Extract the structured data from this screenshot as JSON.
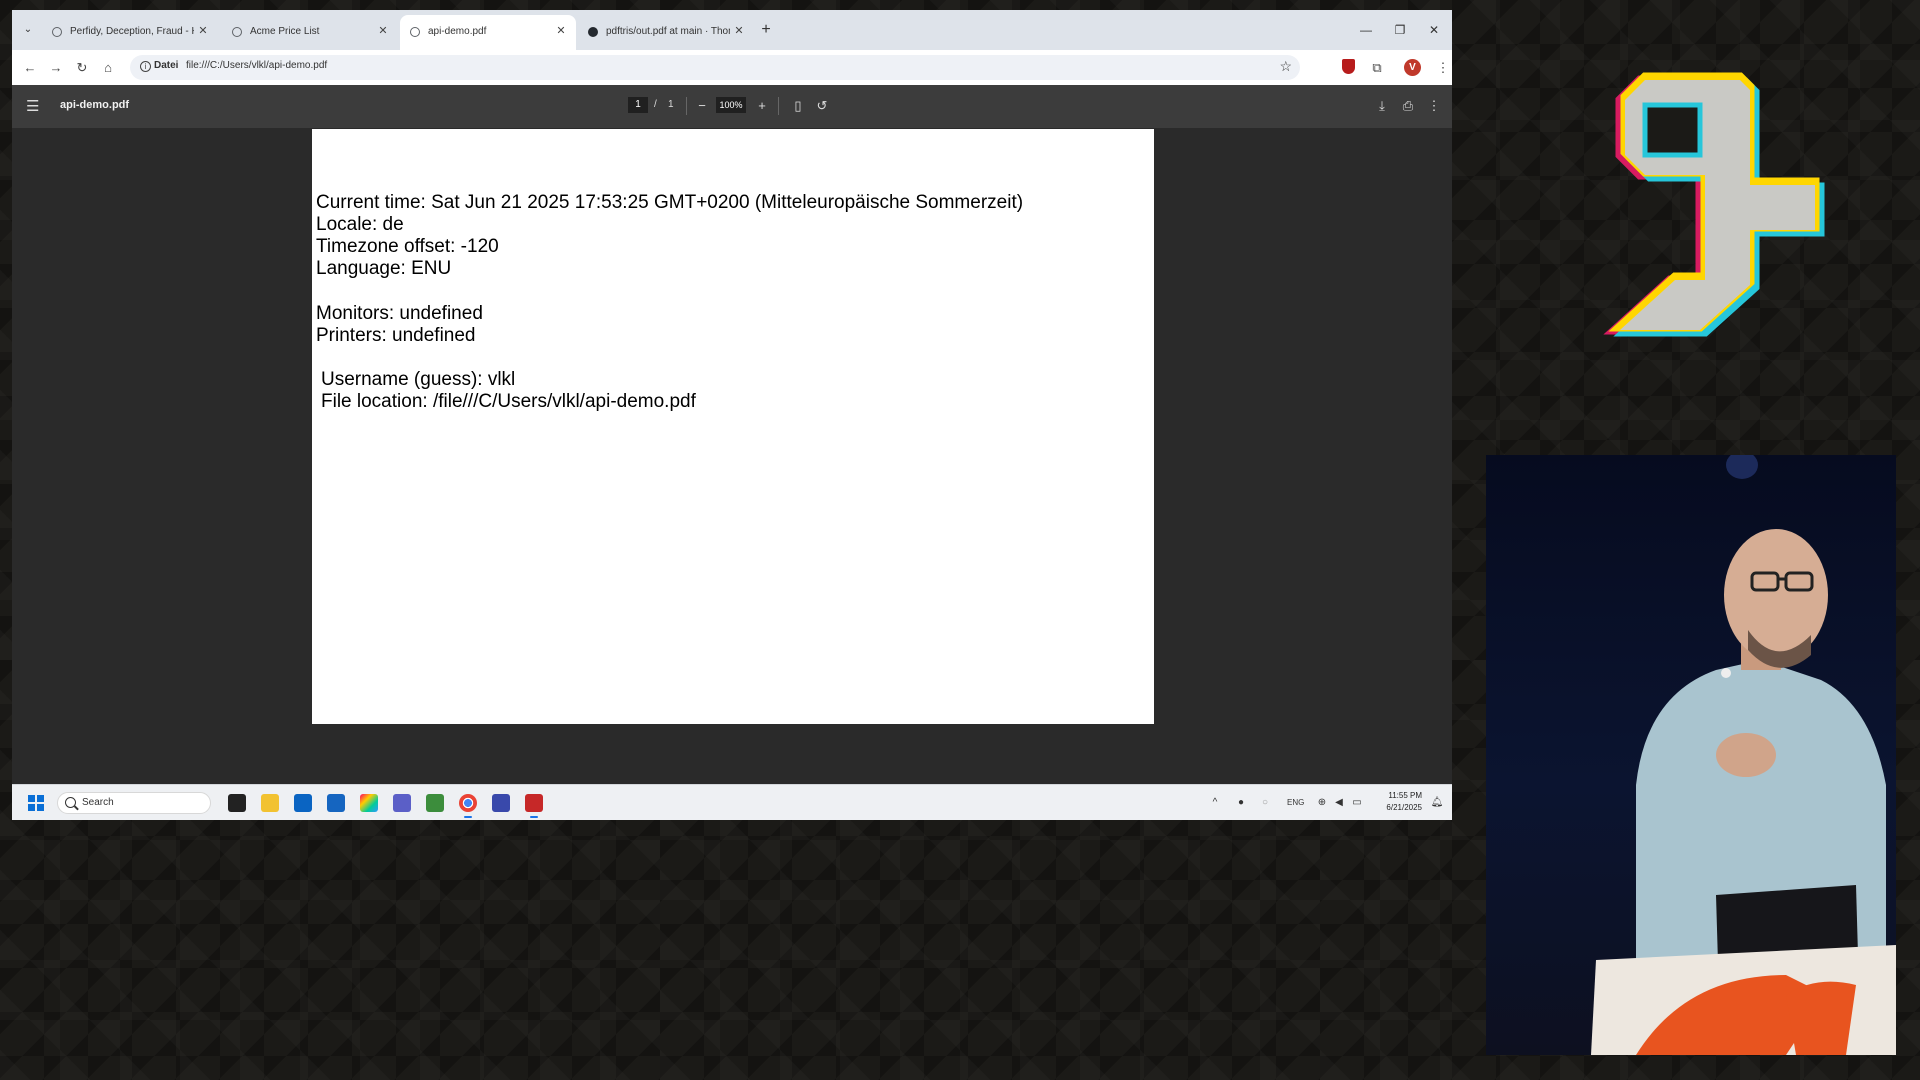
{
  "browser": {
    "tabs": [
      {
        "title": "Perfidy, Deception, Fraud - How",
        "active": false
      },
      {
        "title": "Acme Price List",
        "active": false
      },
      {
        "title": "api-demo.pdf",
        "active": true
      },
      {
        "title": "pdftris/out.pdf at main · Thoma",
        "active": false
      }
    ],
    "new_tab_label": "+",
    "address": {
      "chip": "Datei",
      "url": "file:///C:/Users/vlkl/api-demo.pdf"
    },
    "profile_initial": "V"
  },
  "pdf_viewer": {
    "filename": "api-demo.pdf",
    "current_page": "1",
    "page_separator": "/",
    "total_pages": "1",
    "zoom": "100%",
    "document_lines": [
      "Current time: Sat Jun 21 2025 17:53:25 GMT+0200 (Mitteleuropäische Sommerzeit)",
      "Locale: de",
      "Timezone offset: -120",
      "Language: ENU",
      "Monitors: undefined",
      "Printers: undefined",
      "Username (guess): vlkl",
      "File location: /file///C/Users/vlkl/api-demo.pdf"
    ]
  },
  "taskbar": {
    "search_placeholder": "Search",
    "language": "ENG",
    "time": "11:55 PM",
    "date": "6/21/2025"
  },
  "colors": {
    "accent_blue": "#1a73e8",
    "pdf_toolbar": "#3c3c3c",
    "tabbar": "#dee3ea"
  }
}
